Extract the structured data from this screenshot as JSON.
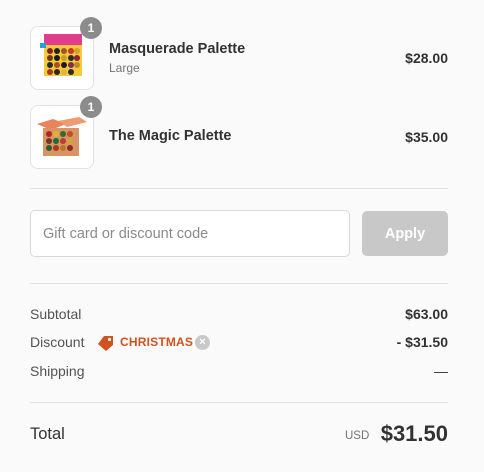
{
  "products": [
    {
      "name": "Masquerade Palette",
      "variant": "Large",
      "price": "$28.00",
      "quantity": "1",
      "icon": "palette-image"
    },
    {
      "name": "The Magic Palette",
      "variant": "",
      "price": "$35.00",
      "quantity": "1",
      "icon": "palette-image"
    }
  ],
  "discount_form": {
    "placeholder": "Gift card or discount code",
    "value": "",
    "apply_label": "Apply"
  },
  "summary": {
    "subtotal_label": "Subtotal",
    "subtotal_value": "$63.00",
    "discount_label": "Discount",
    "discount_code": "CHRISTMAS",
    "discount_value": "- $31.50",
    "shipping_label": "Shipping",
    "shipping_value": "—"
  },
  "total": {
    "label": "Total",
    "currency": "USD",
    "amount": "$31.50"
  },
  "colors": {
    "accent": "#d2521e",
    "badge": "#8c8c8c",
    "apply_disabled": "#c8c8c8"
  }
}
